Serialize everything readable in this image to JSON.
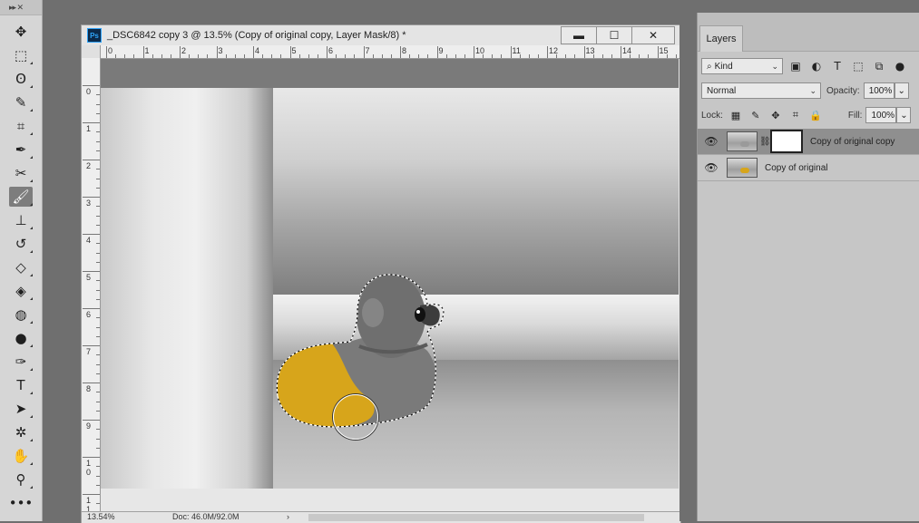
{
  "toolbar": {
    "collapse_label": "▸▸ ✕",
    "tools": [
      {
        "name": "move-tool",
        "icon": "✥"
      },
      {
        "name": "marquee-tool",
        "icon": "⬚"
      },
      {
        "name": "lasso-tool",
        "icon": "ʘ"
      },
      {
        "name": "quick-selection-tool",
        "icon": "✎"
      },
      {
        "name": "crop-tool",
        "icon": "⌗"
      },
      {
        "name": "eyedropper-tool",
        "icon": "✒"
      },
      {
        "name": "healing-brush-tool",
        "icon": "✂"
      },
      {
        "name": "brush-tool",
        "icon": "🖌",
        "active": true
      },
      {
        "name": "clone-stamp-tool",
        "icon": "⊥"
      },
      {
        "name": "history-brush-tool",
        "icon": "↺"
      },
      {
        "name": "eraser-tool",
        "icon": "◇"
      },
      {
        "name": "paint-bucket-tool",
        "icon": "◈"
      },
      {
        "name": "blur-tool",
        "icon": "◍"
      },
      {
        "name": "dodge-tool",
        "icon": "●"
      },
      {
        "name": "pen-tool",
        "icon": "✑"
      },
      {
        "name": "type-tool",
        "icon": "T"
      },
      {
        "name": "path-selection-tool",
        "icon": "➤"
      },
      {
        "name": "custom-shape-tool",
        "icon": "✲"
      },
      {
        "name": "hand-tool",
        "icon": "✋"
      },
      {
        "name": "zoom-tool",
        "icon": "⚲"
      },
      {
        "name": "more-tools",
        "icon": "•••"
      }
    ]
  },
  "document": {
    "icon_label": "Ps",
    "title": "_DSC6842 copy 3 @ 13.5% (Copy of original copy, Layer Mask/8) *",
    "minimize": "▬",
    "maximize": "☐",
    "close": "✕",
    "ruler_top": [
      "0",
      "1",
      "2",
      "3",
      "4",
      "5",
      "6",
      "7",
      "8",
      "9",
      "10",
      "11",
      "12",
      "13",
      "14",
      "15"
    ],
    "ruler_left": [
      "0",
      "1",
      "2",
      "3",
      "4",
      "5",
      "6",
      "7",
      "8",
      "9",
      "1 0",
      "1 1"
    ],
    "status_zoom": "13.54%",
    "status_doc": "Doc: 46.0M/92.0M",
    "status_arrow": "›"
  },
  "layers_panel": {
    "tab": "Layers",
    "filter_kind": "Kind",
    "blend_mode": "Normal",
    "opacity_label": "Opacity:",
    "opacity_value": "100%",
    "lock_label": "Lock:",
    "fill_label": "Fill:",
    "fill_value": "100%",
    "layers": [
      {
        "name": "Copy of original copy",
        "selected": true,
        "has_mask": true
      },
      {
        "name": "Copy of original",
        "selected": false,
        "has_mask": false
      }
    ]
  },
  "colors": {
    "accent_selected_layer": "#8f8f8f",
    "duck_yellow": "#d7a51b",
    "ps_blue": "#2fa3f7"
  }
}
